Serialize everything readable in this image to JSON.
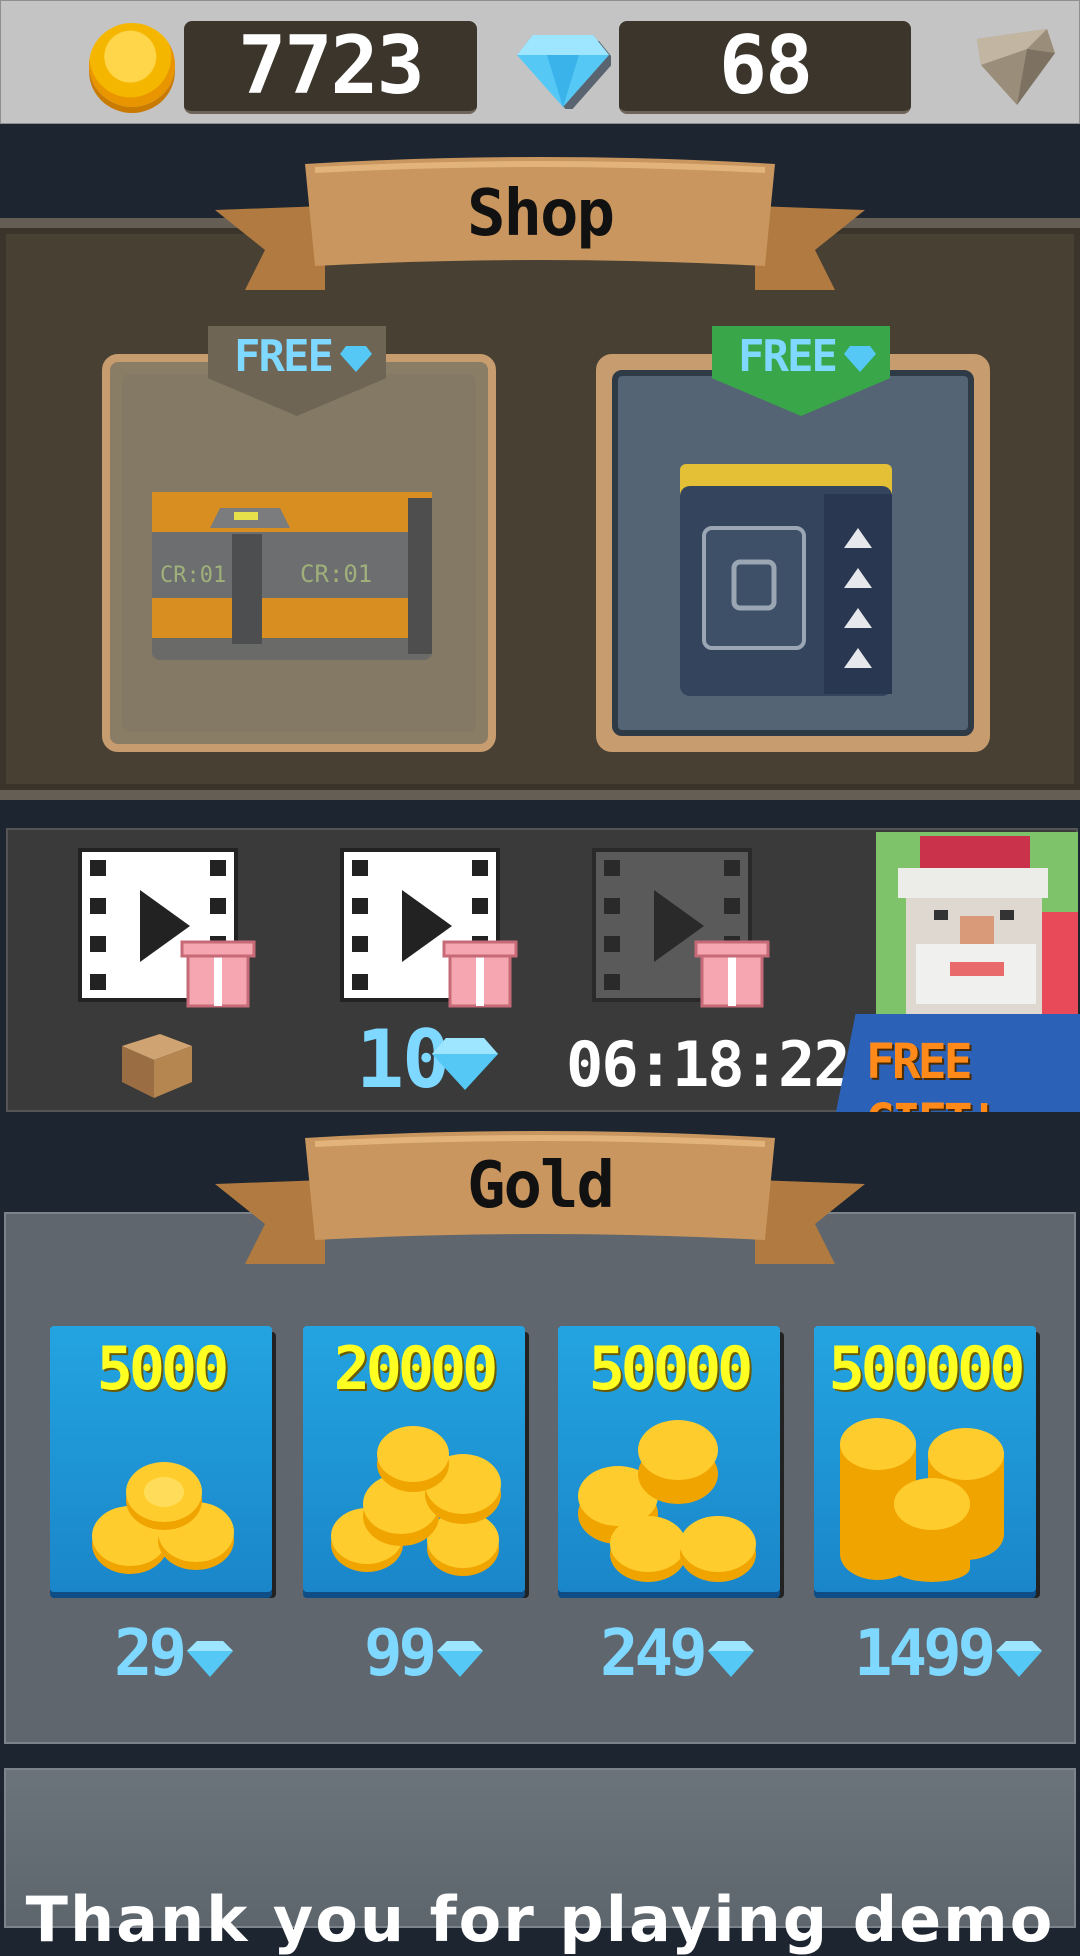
{
  "currency": {
    "coins": "7723",
    "gems": "68"
  },
  "shop": {
    "title": "Shop",
    "chests": [
      {
        "name": "CR.01 crate",
        "badge": "FREE",
        "label_left": "CR:01",
        "label_right": "CR:01"
      },
      {
        "name": "steel crate",
        "badge": "FREE"
      }
    ]
  },
  "videos": {
    "rewards": [
      {
        "reward": "box-icon"
      },
      {
        "reward": "10"
      },
      {
        "reward": "06:18:22"
      }
    ],
    "free_gift": "FREE GIFT!"
  },
  "gold": {
    "title": "Gold",
    "packs": [
      {
        "amount": "5000",
        "price": "29"
      },
      {
        "amount": "20000",
        "price": "99"
      },
      {
        "amount": "50000",
        "price": "249"
      },
      {
        "amount": "500000",
        "price": "1499"
      }
    ]
  },
  "footer": {
    "message": "Thank you for playing demo"
  },
  "colors": {
    "gem": "#55c8f5",
    "coin": "#f5b600",
    "gold_price": "#7fd8ff",
    "banner": "#c8965e"
  }
}
